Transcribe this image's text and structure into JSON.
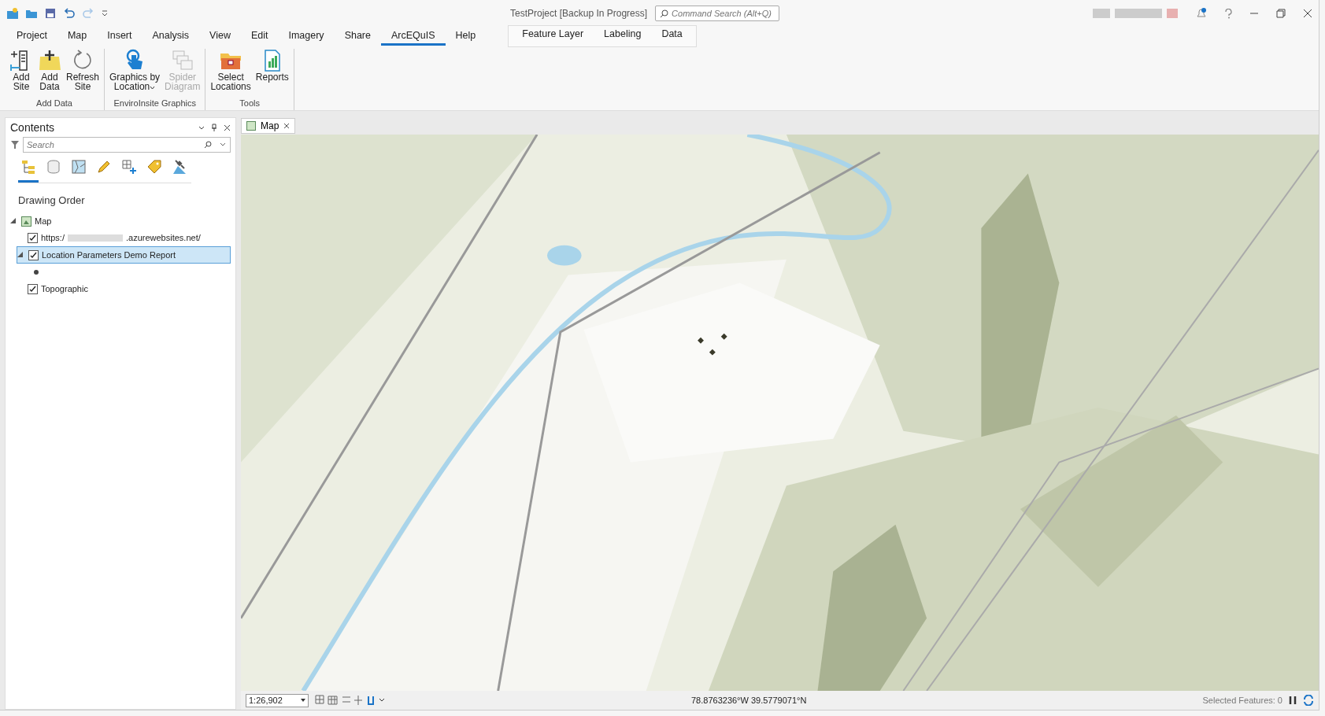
{
  "window": {
    "title": "TestProject [Backup In Progress]"
  },
  "command_search": {
    "placeholder": "Command Search (Alt+Q)"
  },
  "ribbon_tabs": [
    {
      "label": "Project",
      "selected": false
    },
    {
      "label": "Map",
      "selected": false
    },
    {
      "label": "Insert",
      "selected": false
    },
    {
      "label": "Analysis",
      "selected": false
    },
    {
      "label": "View",
      "selected": false
    },
    {
      "label": "Edit",
      "selected": false
    },
    {
      "label": "Imagery",
      "selected": false
    },
    {
      "label": "Share",
      "selected": false
    },
    {
      "label": "ArcEQuIS",
      "selected": true
    },
    {
      "label": "Help",
      "selected": false
    }
  ],
  "contextual_tabs": [
    {
      "label": "Feature Layer",
      "selected": false
    },
    {
      "label": "Labeling",
      "selected": false
    },
    {
      "label": "Data",
      "selected": false
    }
  ],
  "ribbon_groups": [
    {
      "label": "Add Data",
      "buttons": [
        {
          "label": "Add\nSite",
          "kind": "add-site",
          "disabled": false,
          "dropdown": false
        },
        {
          "label": "Add\nData",
          "kind": "add-data",
          "disabled": false,
          "dropdown": false
        },
        {
          "label": "Refresh\nSite",
          "kind": "refresh",
          "disabled": false,
          "dropdown": false
        }
      ]
    },
    {
      "label": "EnviroInsite Graphics",
      "buttons": [
        {
          "label": "Graphics by\nLocation",
          "kind": "pointer",
          "disabled": false,
          "dropdown": true
        },
        {
          "label": "Spider\nDiagram",
          "kind": "spider",
          "disabled": true,
          "dropdown": false
        }
      ]
    },
    {
      "label": "Tools",
      "buttons": [
        {
          "label": "Select\nLocations",
          "kind": "toolbox",
          "disabled": false,
          "dropdown": false
        },
        {
          "label": "Reports",
          "kind": "report",
          "disabled": false,
          "dropdown": false
        }
      ]
    }
  ],
  "contents": {
    "title": "Contents",
    "search": {
      "placeholder": "Search"
    },
    "view_tabs": [
      {
        "kind": "order",
        "selected": true
      },
      {
        "kind": "source",
        "selected": false
      },
      {
        "kind": "selection",
        "selected": false
      },
      {
        "kind": "editing",
        "selected": false
      },
      {
        "kind": "snapping",
        "selected": false
      },
      {
        "kind": "labeling",
        "selected": false
      },
      {
        "kind": "imagery",
        "selected": false
      }
    ],
    "heading": "Drawing Order",
    "tree": [
      {
        "label": "Map",
        "kind": "map",
        "expanded": true,
        "selected": false,
        "children": [
          {
            "label": "https:/",
            "label_end": ".azurewebsites.net/",
            "checked": true,
            "selected": false
          },
          {
            "label": "Location Parameters Demo Report",
            "checked": true,
            "selected": true,
            "expanded": true,
            "children": [
              {
                "kind": "symbol"
              }
            ]
          },
          {
            "label": "Topographic",
            "checked": true,
            "selected": false
          }
        ]
      }
    ]
  },
  "map_view": {
    "tabs": [
      {
        "label": "Map",
        "selected": true
      }
    ]
  },
  "status_bar": {
    "scale": "1:26,902",
    "coordinates": "78.8763236°W 39.5779071°N",
    "selected_features": "Selected Features: 0"
  }
}
